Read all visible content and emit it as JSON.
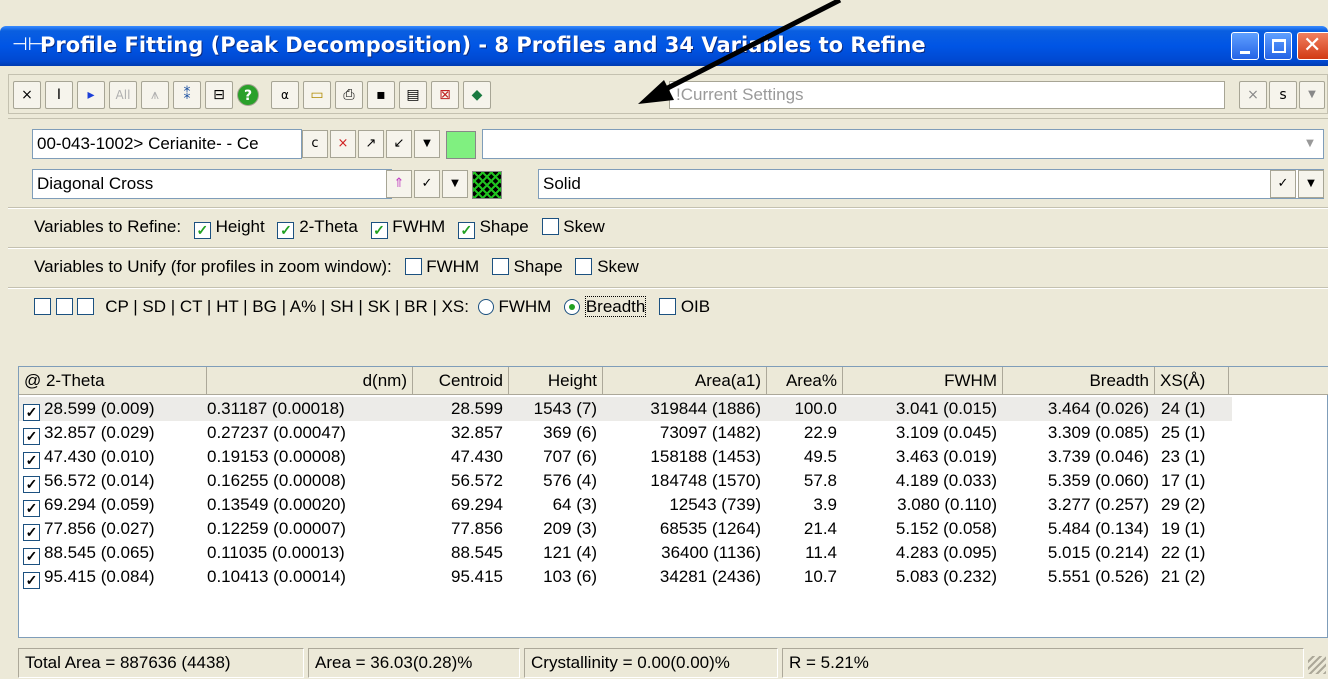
{
  "window": {
    "title": "Profile Fitting (Peak Decomposition) - 8 Profiles and 34 Variables to Refine"
  },
  "toolbar": {
    "buttons": [
      "×",
      "I",
      "▸",
      "All",
      "⩚",
      "⁑",
      "⊟",
      "?",
      "α",
      "▭",
      "⎙",
      "▪",
      "▤",
      "⊠",
      "◆"
    ],
    "settings_value": "!Current Settings",
    "right": {
      "x": "×",
      "s": "s",
      "dd": "▼"
    }
  },
  "phase": {
    "value": "00-043-1002> Cerianite- - Ce",
    "btn_c": "c",
    "btn_x": "×",
    "color_swatch": "#80f080",
    "right_value": ""
  },
  "pattern": {
    "value": "Diagonal Cross",
    "fill_label": "Solid"
  },
  "refine": {
    "label": "Variables to Refine:",
    "items": [
      {
        "label": "Height",
        "checked": true
      },
      {
        "label": "2-Theta",
        "checked": true
      },
      {
        "label": "FWHM",
        "checked": true
      },
      {
        "label": "Shape",
        "checked": true
      },
      {
        "label": "Skew",
        "checked": false
      }
    ]
  },
  "unify": {
    "label": "Variables to Unify (for profiles in zoom window):",
    "items": [
      {
        "label": "FWHM",
        "checked": false
      },
      {
        "label": "Shape",
        "checked": false
      },
      {
        "label": "Skew",
        "checked": false
      }
    ]
  },
  "options": {
    "text": "CP  | SD | CT | HT | BG | A% | SH | SK | BR | XS:",
    "fwhm_label": "FWHM",
    "breadth_label": "Breadth",
    "oib_label": "OIB"
  },
  "table": {
    "columns": [
      "@ 2-Theta",
      "d(nm)",
      "Centroid",
      "Height",
      "Area(a1)",
      "Area%",
      "FWHM",
      "Breadth",
      "XS(Å)"
    ],
    "rows": [
      [
        "28.599 (0.009)",
        "0.31187 (0.00018)",
        "28.599",
        "1543 (7)",
        "319844 (1886)",
        "100.0",
        "3.041 (0.015)",
        "3.464 (0.026)",
        "24 (1)"
      ],
      [
        "32.857 (0.029)",
        "0.27237 (0.00047)",
        "32.857",
        "369 (6)",
        "73097 (1482)",
        "22.9",
        "3.109 (0.045)",
        "3.309 (0.085)",
        "25 (1)"
      ],
      [
        "47.430 (0.010)",
        "0.19153 (0.00008)",
        "47.430",
        "707 (6)",
        "158188 (1453)",
        "49.5",
        "3.463 (0.019)",
        "3.739 (0.046)",
        "23 (1)"
      ],
      [
        "56.572 (0.014)",
        "0.16255 (0.00008)",
        "56.572",
        "576 (4)",
        "184748 (1570)",
        "57.8",
        "4.189 (0.033)",
        "5.359 (0.060)",
        "17 (1)"
      ],
      [
        "69.294 (0.059)",
        "0.13549 (0.00020)",
        "69.294",
        "64 (3)",
        "12543 (739)",
        "3.9",
        "3.080 (0.110)",
        "3.277 (0.257)",
        "29 (2)"
      ],
      [
        "77.856 (0.027)",
        "0.12259 (0.00007)",
        "77.856",
        "209 (3)",
        "68535 (1264)",
        "21.4",
        "5.152 (0.058)",
        "5.484 (0.134)",
        "19 (1)"
      ],
      [
        "88.545 (0.065)",
        "0.11035 (0.00013)",
        "88.545",
        "121 (4)",
        "36400 (1136)",
        "11.4",
        "4.283 (0.095)",
        "5.015 (0.214)",
        "22 (1)"
      ],
      [
        "95.415 (0.084)",
        "0.10413 (0.00014)",
        "95.415",
        "103 (6)",
        "34281 (2436)",
        "10.7",
        "5.083 (0.232)",
        "5.551 (0.526)",
        "21 (2)"
      ]
    ]
  },
  "status": {
    "total_area": "Total Area = 887636 (4438)",
    "area": "Area = 36.03(0.28)%",
    "crystallinity": "Crystallinity = 0.00(0.00)%",
    "r": "R = 5.21%"
  }
}
